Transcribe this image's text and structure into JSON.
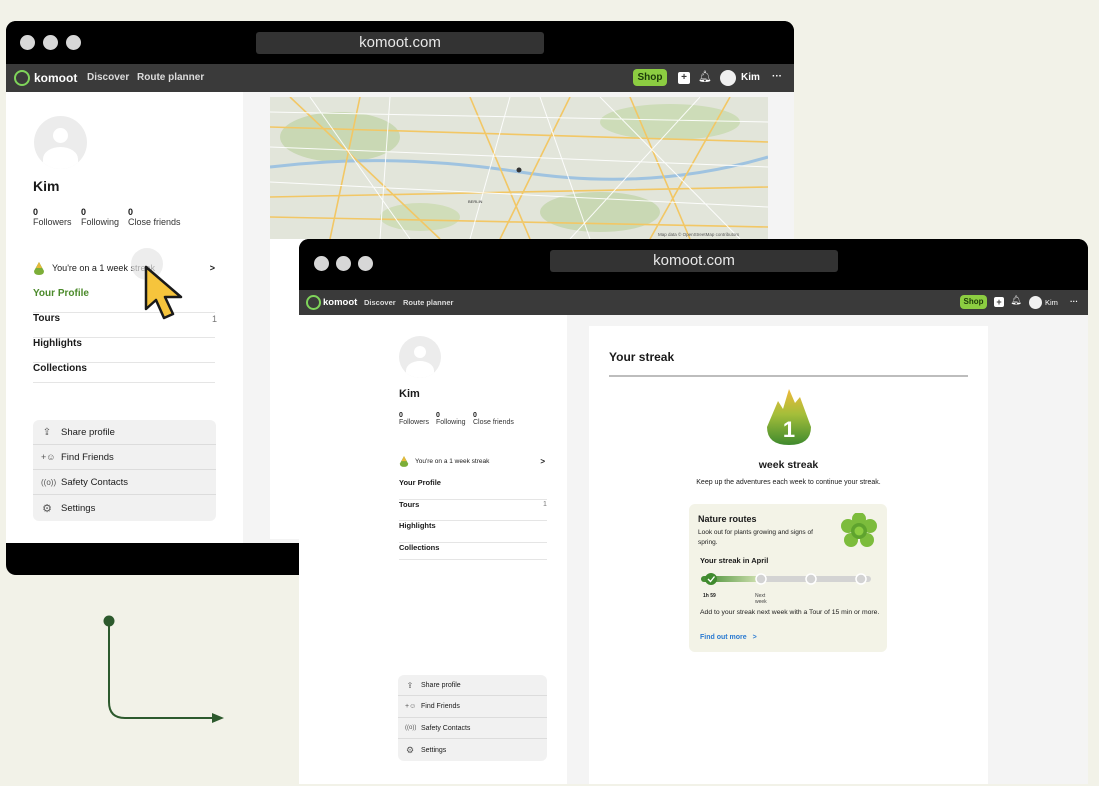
{
  "browser": {
    "url": "komoot.com"
  },
  "nav": {
    "brand": "komoot",
    "links": [
      "Discover",
      "Route planner"
    ],
    "shop": "Shop",
    "user": "Kim",
    "more": "···"
  },
  "profile": {
    "name": "Kim",
    "stats": [
      {
        "count": "0",
        "label": "Followers"
      },
      {
        "count": "0",
        "label": "Following"
      },
      {
        "count": "0",
        "label": "Close friends"
      }
    ],
    "streak_banner": "You're on a 1 week streak",
    "chevron": ">",
    "menu": [
      {
        "label": "Your Profile",
        "count": ""
      },
      {
        "label": "Tours",
        "count": "1"
      },
      {
        "label": "Highlights",
        "count": ""
      },
      {
        "label": "Collections",
        "count": ""
      }
    ],
    "actions": [
      {
        "label": "Share profile",
        "icon": "share-icon"
      },
      {
        "label": "Find Friends",
        "icon": "add-friends-icon"
      },
      {
        "label": "Safety Contacts",
        "icon": "safety-icon"
      },
      {
        "label": "Settings",
        "icon": "gear-icon"
      }
    ]
  },
  "map": {
    "city_label": "BERLIN",
    "attribution": "Map data © OpenStreetMap contributors"
  },
  "streak": {
    "title": "Your streak",
    "number": "1",
    "headline": "week streak",
    "subtext": "Keep up the adventures each week to continue your streak.",
    "card": {
      "title": "Nature routes",
      "desc": "Look out for plants growing and signs of spring.",
      "month_title": "Your streak in April",
      "progress": {
        "weeks_completed": 1,
        "weeks_total": 4
      },
      "label_done": "1h 59",
      "label_next": "Next week",
      "note": "Add to your streak next week with a Tour of 15 min or more.",
      "link": "Find out more",
      "link_chevron": ">"
    }
  },
  "colors": {
    "accent": "#8ccd41",
    "streak_green": "#4f8f2c",
    "link_blue": "#2a7ad1",
    "card_bg": "#f3f3e7",
    "connector": "#2d5a2d",
    "cursor": "#f6c43c"
  }
}
